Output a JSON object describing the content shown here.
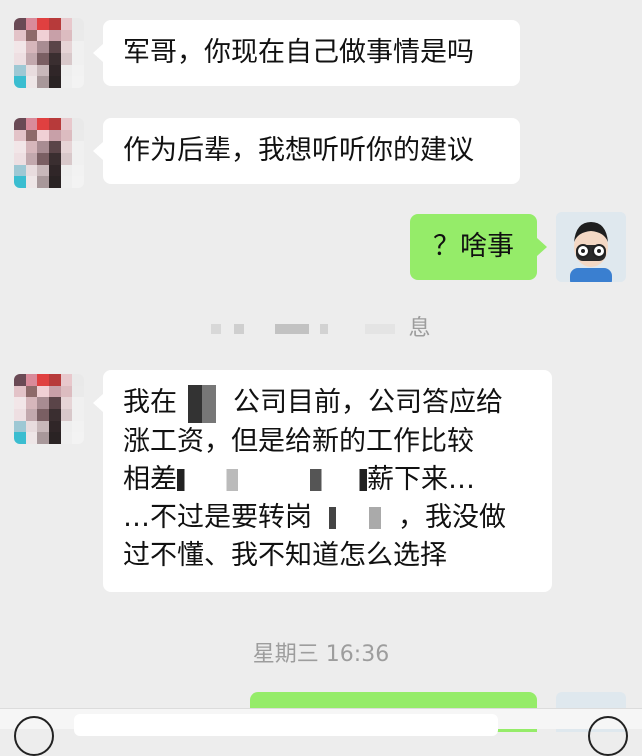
{
  "messages": {
    "m1": "军哥，你现在自己做事情是吗",
    "m2": "作为后辈，我想听听你的建议",
    "m3": "？啥事",
    "sys1_visible": "息",
    "m4_l1a": "我在",
    "m4_l1b": "公司目前，公司答应给",
    "m4_l2a": "涨工资",
    "m4_l2b": "，但是给新的工作比较",
    "m4_l3a": "相差",
    "m4_l3b": "薪下来…",
    "m4_l4a": "…不过是要转岗",
    "m4_l4b": "，我没做",
    "m4_l5": "过不懂、我不知道怎么选择",
    "timestamp": "星期三 16:36"
  },
  "colors": {
    "background": "#ededed",
    "bubble_in": "#ffffff",
    "bubble_out": "#95ec69"
  }
}
